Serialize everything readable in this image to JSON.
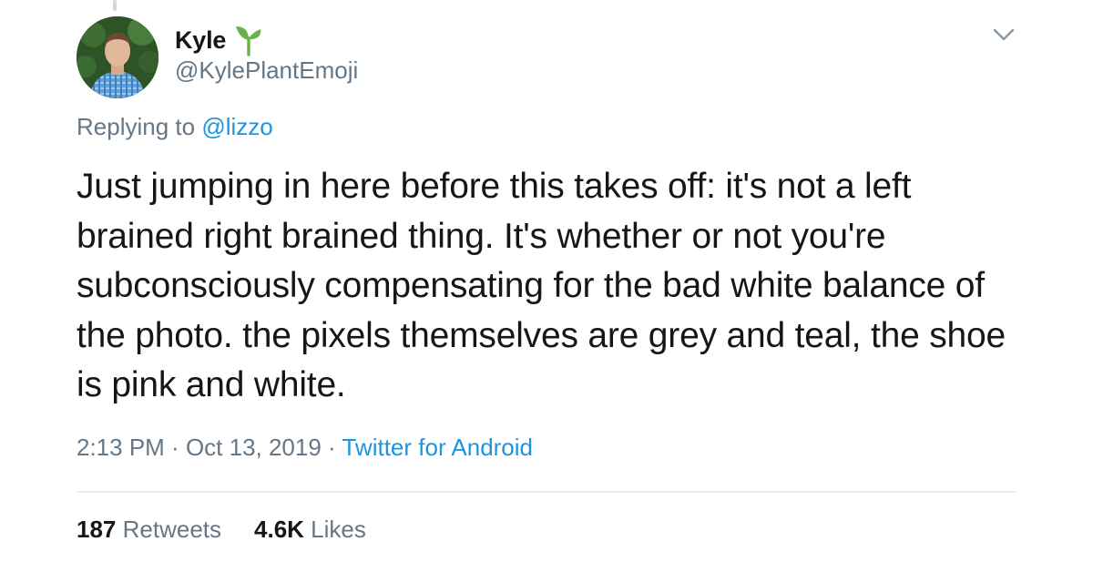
{
  "tweet": {
    "author": {
      "display_name": "Kyle",
      "handle": "@KylePlantEmoji",
      "name_emoji": "seedling-icon"
    },
    "reply_prefix": "Replying to ",
    "reply_to": "@lizzo",
    "text": "Just jumping in here before this takes off: it's not a left brained right brained thing. It's whether or not you're subconsciously compensating for the bad white balance of the photo. the pixels themselves are grey and teal, the shoe is pink and white.",
    "time": "2:13 PM",
    "separator": " · ",
    "date": "Oct 13, 2019",
    "source": "Twitter for Android",
    "stats": {
      "retweets_count": "187",
      "retweets_label": "Retweets",
      "likes_count": "4.6K",
      "likes_label": "Likes"
    }
  },
  "colors": {
    "link": "#1b95e0",
    "secondary_text": "#657786",
    "primary_text": "#14171a",
    "divider": "#e6ecf0",
    "seedling": "#6ab04c"
  },
  "icons": {
    "menu": "chevron-down-icon",
    "avatar": "avatar"
  }
}
